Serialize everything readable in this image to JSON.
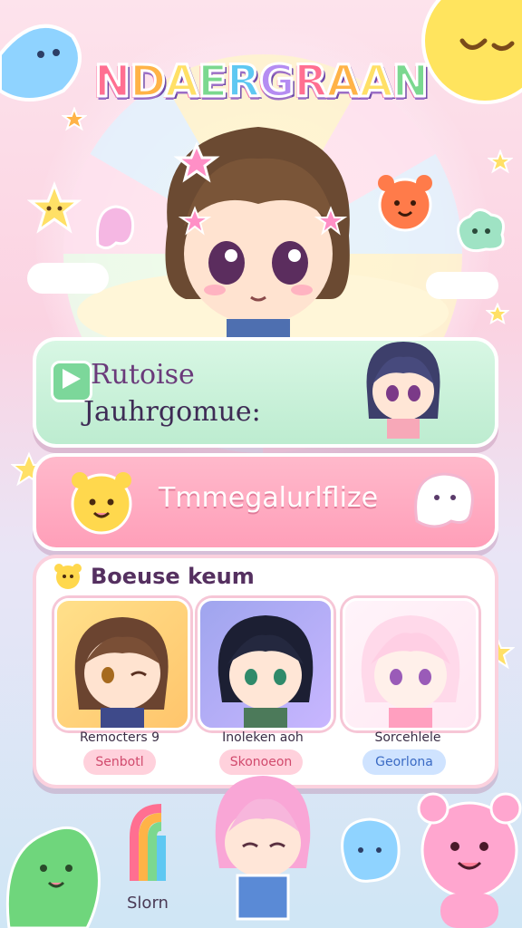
{
  "title": "NDAERGRAAN",
  "banner_green": {
    "line1": "Rutoise",
    "line2": "Jauhrgomue:"
  },
  "banner_pink": {
    "label": "Tmmegalurlflize"
  },
  "roster": {
    "heading": "Boeuse keum",
    "cards": [
      {
        "caption": "Remocters 9",
        "badge": "Senbotl"
      },
      {
        "caption": "Inoleken aoh",
        "badge": "Skonoeon"
      },
      {
        "caption": "Sorcehlele",
        "badge": "Georlona"
      }
    ]
  },
  "bottom_label": "Slorn",
  "icons": [
    "play-icon",
    "star-icon",
    "bear-icon",
    "ghost-icon",
    "smiley-sun-icon",
    "rainbow-icon",
    "dinosaur-icon",
    "pink-bear-icon",
    "blob-icon"
  ],
  "colors": {
    "accent_pink": "#ff9fb9",
    "accent_green": "#bdecd0",
    "accent_purple": "#6f4aa8"
  }
}
